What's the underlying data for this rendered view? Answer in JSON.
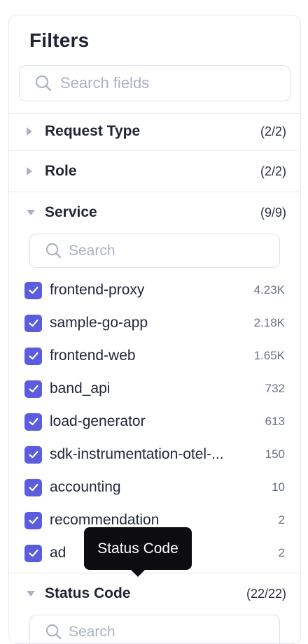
{
  "filters": {
    "title": "Filters",
    "search_placeholder": "Search fields"
  },
  "sections": [
    {
      "name": "Request Type",
      "count": "(2/2)",
      "expanded": false
    },
    {
      "name": "Role",
      "count": "(2/2)",
      "expanded": false
    },
    {
      "name": "Service",
      "count": "(9/9)",
      "expanded": true,
      "search_placeholder": "Search"
    },
    {
      "name": "Status Code",
      "count": "(22/22)",
      "expanded": true,
      "search_placeholder": "Search"
    }
  ],
  "service_options": [
    {
      "label": "frontend-proxy",
      "count": "4.23K",
      "checked": true
    },
    {
      "label": "sample-go-app",
      "count": "2.18K",
      "checked": true
    },
    {
      "label": "frontend-web",
      "count": "1.65K",
      "checked": true
    },
    {
      "label": "band_api",
      "count": "732",
      "checked": true
    },
    {
      "label": "load-generator",
      "count": "613",
      "checked": true
    },
    {
      "label": "sdk-instrumentation-otel-...",
      "count": "150",
      "checked": true
    },
    {
      "label": "accounting",
      "count": "10",
      "checked": true
    },
    {
      "label": "recommendation",
      "count": "2",
      "checked": true
    },
    {
      "label": "ad",
      "count": "2",
      "checked": true
    }
  ],
  "tooltip": {
    "text": "Status Code"
  },
  "colors": {
    "accent": "#5b5ce0",
    "caret": "#a9b1c2",
    "border": "#e6e8ee",
    "tooltip_bg": "#0d0d0f"
  }
}
